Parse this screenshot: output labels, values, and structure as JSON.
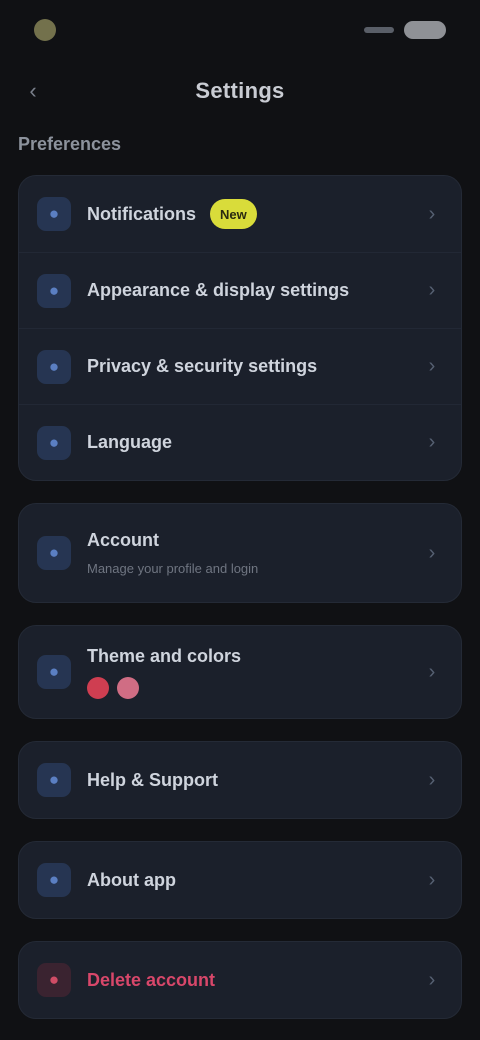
{
  "status": {
    "time": "",
    "battery": ""
  },
  "header": {
    "title": "Settings",
    "back_icon": "back-arrow-icon"
  },
  "section": {
    "label": "Preferences"
  },
  "groups": [
    {
      "items": [
        {
          "label": "Notifications",
          "badge": "New",
          "icon": "bell-icon"
        },
        {
          "label": "Appearance & display settings",
          "icon": "palette-icon"
        },
        {
          "label": "Privacy & security settings",
          "icon": "lock-icon"
        },
        {
          "label": "Language",
          "icon": "globe-icon"
        }
      ]
    },
    {
      "items": [
        {
          "label": "Account",
          "sub": "Manage your profile and login",
          "icon": "user-icon"
        }
      ]
    },
    {
      "items": [
        {
          "label": "Theme and colors",
          "icon": "brush-icon",
          "swatches": [
            "#cf3e51",
            "#d06d84"
          ]
        }
      ]
    },
    {
      "items": [
        {
          "label": "Help & Support",
          "icon": "help-icon"
        }
      ]
    },
    {
      "items": [
        {
          "label": "About app",
          "icon": "info-icon"
        }
      ]
    },
    {
      "items": [
        {
          "label": "Delete account",
          "icon": "trash-icon",
          "danger": true
        }
      ]
    }
  ],
  "colors": {
    "background": "#101114",
    "card": "#1b202b",
    "accent": "#5b7fc2",
    "badge": "#d9dc3a",
    "danger": "#d8476a"
  }
}
